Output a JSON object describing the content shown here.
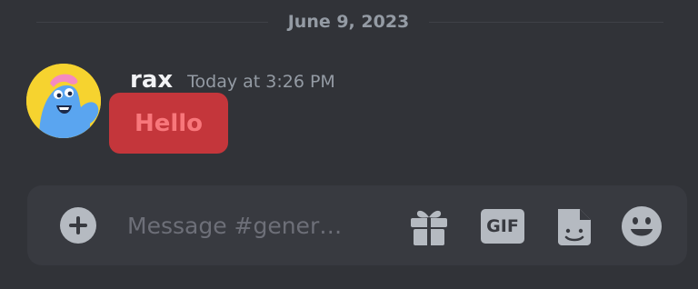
{
  "date_divider": {
    "text": "June 9, 2023"
  },
  "message": {
    "username": "rax",
    "timestamp": "Today at 3:26 PM",
    "text": "Hello"
  },
  "composer": {
    "placeholder": "Message #gener…",
    "gif_label": "GIF",
    "icons": [
      "plus-icon",
      "gift-icon",
      "gif-icon",
      "sticker-icon",
      "emoji-icon"
    ]
  },
  "colors": {
    "background": "#313338",
    "composer_background": "#383a40",
    "message_highlight": "#c4363b",
    "message_text": "#f8777b",
    "username": "#f2f3f5",
    "muted_text": "#949ba4",
    "icon": "#b5bac1",
    "avatar_background": "#f6d32f"
  }
}
